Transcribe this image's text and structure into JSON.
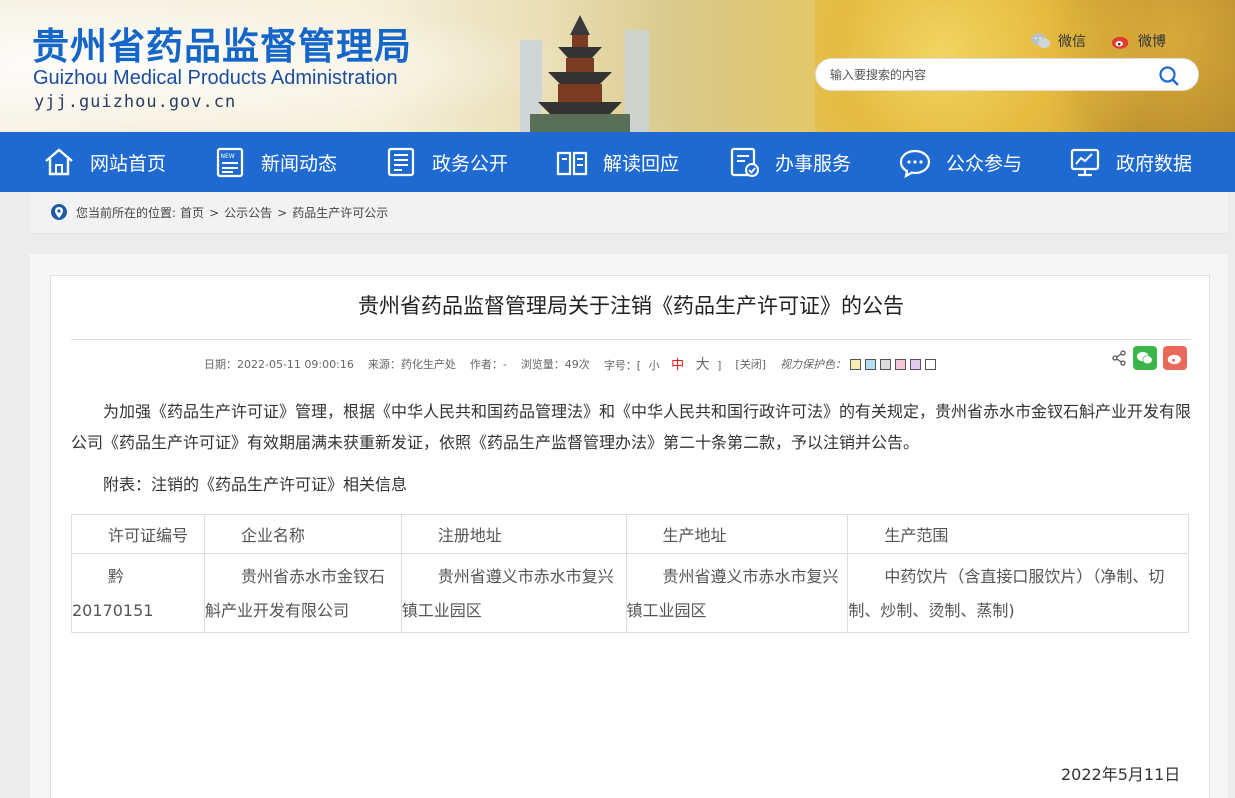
{
  "header": {
    "title_cn": "贵州省药品监督管理局",
    "title_en": "Guizhou Medical Products Administration",
    "url": "yjj.guizhou.gov.cn",
    "wechat_label": "微信",
    "weibo_label": "微博",
    "search_placeholder": "输入要搜索的内容"
  },
  "nav": {
    "items": [
      {
        "label": "网站首页",
        "icon": "home-icon"
      },
      {
        "label": "新闻动态",
        "icon": "news-icon"
      },
      {
        "label": "政务公开",
        "icon": "document-icon"
      },
      {
        "label": "解读回应",
        "icon": "book-icon"
      },
      {
        "label": "办事服务",
        "icon": "service-icon"
      },
      {
        "label": "公众参与",
        "icon": "chat-icon"
      },
      {
        "label": "政府数据",
        "icon": "data-icon"
      }
    ]
  },
  "breadcrumb": {
    "prefix": "您当前所在的位置:",
    "items": [
      "首页",
      "公示公告",
      "药品生产许可公示"
    ]
  },
  "article": {
    "title": "贵州省药品监督管理局关于注销《药品生产许可证》的公告",
    "meta": {
      "date": "日期：2022-05-11 09:00:16",
      "source": "来源：药化生产处",
      "author": "作者：-",
      "views": "浏览量：49次",
      "fontsize_label": "字号：[",
      "fs_small": "小",
      "fs_mid": "中",
      "fs_big": "大",
      "fontsize_end": "]",
      "close": "[关闭]",
      "vision_label": "视力保护色：",
      "swatches": [
        "#f7ecb6",
        "#b6ddf2",
        "#dcdcdc",
        "#f2c9d6",
        "#e2cdee",
        "#ffffff"
      ]
    },
    "para1": "为加强《药品生产许可证》管理，根据《中华人民共和国药品管理法》和《中华人民共和国行政许可法》的有关规定，贵州省赤水市金钗石斛产业开发有限公司《药品生产许可证》有效期届满未获重新发证，依照《药品生产监督管理办法》第二十条第二款，予以注销并公告。",
    "para2": "附表：注销的《药品生产许可证》相关信息",
    "table": {
      "headers": [
        "许可证编号",
        "企业名称",
        "注册地址",
        "生产地址",
        "生产范围"
      ],
      "rows": [
        [
          "黔 20170151",
          "贵州省赤水市金钗石斛产业开发有限公司",
          "贵州省遵义市赤水市复兴镇工业园区",
          "贵州省遵义市赤水市复兴镇工业园区",
          "中药饮片（含直接口服饮片）（净制、切制、炒制、烫制、蒸制)"
        ]
      ]
    },
    "sign_date": "2022年5月11日"
  }
}
